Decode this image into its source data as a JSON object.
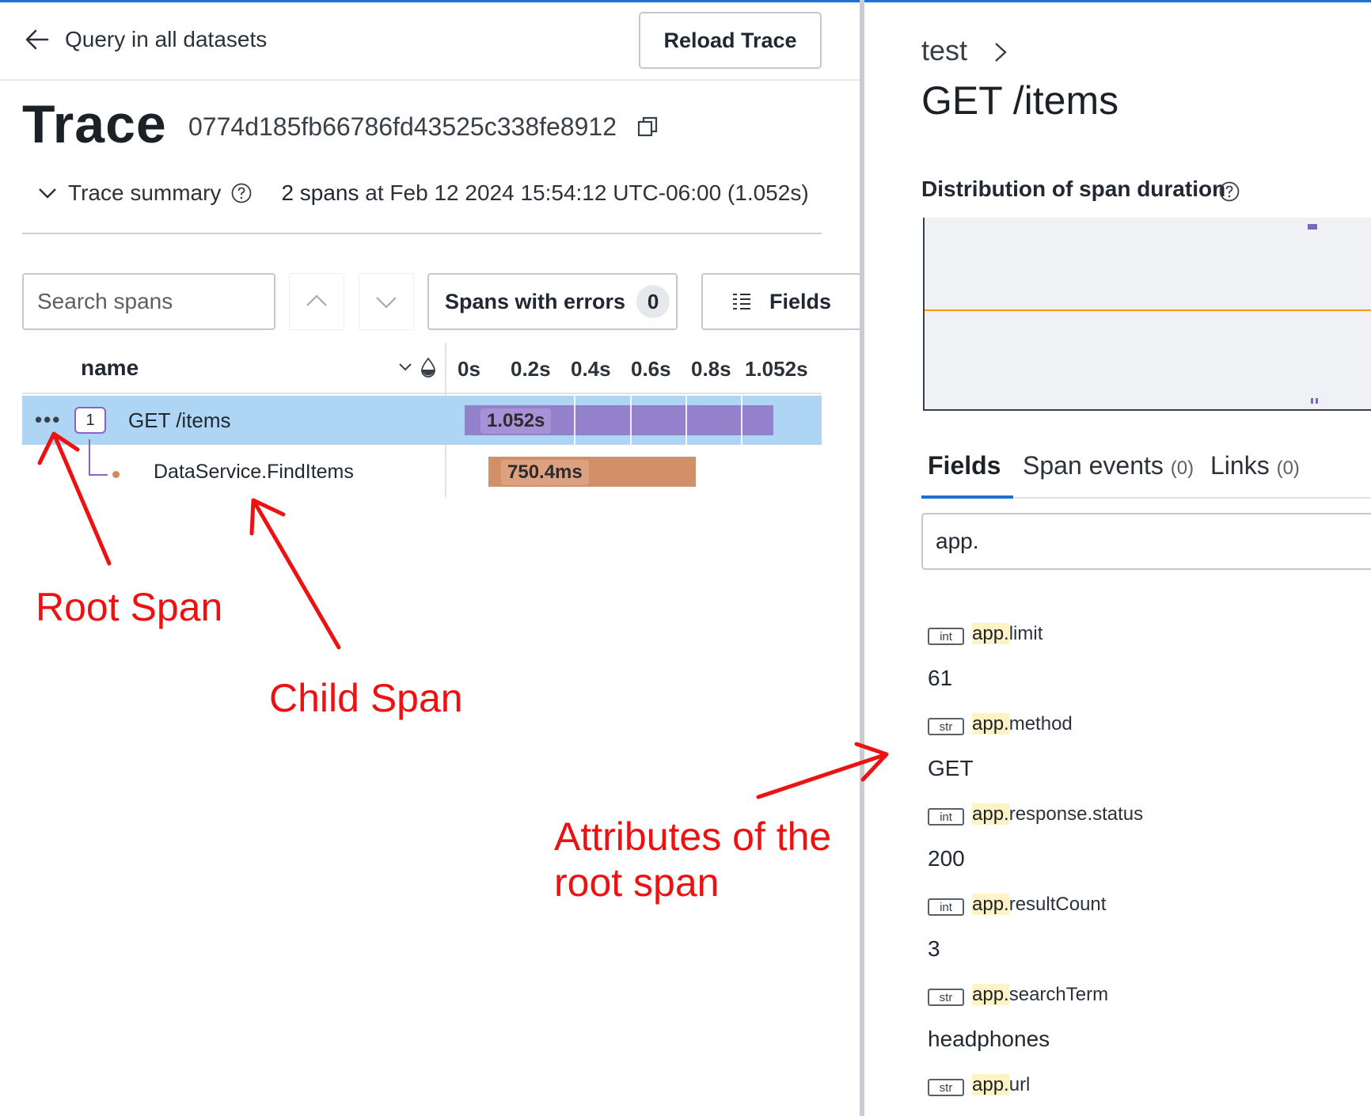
{
  "header": {
    "back_label": "Query in all datasets",
    "reload_label": "Reload Trace"
  },
  "trace": {
    "title": "Trace",
    "id": "0774d185fb66786fd43525c338fe8912",
    "summary_label": "Trace summary",
    "summary_count": "2 spans",
    "summary_at": " at Feb 12 2024 15:54:12 UTC-06:00 (1.052s)"
  },
  "toolbar": {
    "search_placeholder": "Search spans",
    "errors_label": "Spans with errors",
    "errors_count": "0",
    "fields_label": "Fields"
  },
  "columns": {
    "name": "name",
    "ticks": [
      "0s",
      "0.2s",
      "0.4s",
      "0.6s",
      "0.8s",
      "1.052s"
    ]
  },
  "spans": [
    {
      "name": "GET /items",
      "duration": "1.052s",
      "child_count": "1",
      "color": "#9381cc"
    },
    {
      "name": "DataService.FindItems",
      "duration": "750.4ms",
      "color": "#d38f68"
    }
  ],
  "annotations": {
    "root": "Root Span",
    "child": "Child Span",
    "attributes": "Attributes of the root span"
  },
  "detail": {
    "breadcrumb": "test",
    "span_name": "GET /items",
    "distribution_title": "Distribution of span duration",
    "tabs": [
      {
        "label": "Fields",
        "count": ""
      },
      {
        "label": "Span events",
        "count": "(0)"
      },
      {
        "label": "Links",
        "count": "(0)"
      }
    ],
    "filter_value": "app.",
    "fields": [
      {
        "type": "int",
        "prefix": "app.",
        "key": "limit",
        "value": "61"
      },
      {
        "type": "str",
        "prefix": "app.",
        "key": "method",
        "value": "GET"
      },
      {
        "type": "int",
        "prefix": "app.",
        "key": "response.status",
        "value": "200"
      },
      {
        "type": "int",
        "prefix": "app.",
        "key": "resultCount",
        "value": "3"
      },
      {
        "type": "str",
        "prefix": "app.",
        "key": "searchTerm",
        "value": "headphones"
      },
      {
        "type": "str",
        "prefix": "app.",
        "key": "url",
        "value": ""
      }
    ]
  },
  "colors": {
    "accent": "#1d72d3",
    "selected_row": "#aed6f4",
    "annotation": "#ee1111"
  }
}
